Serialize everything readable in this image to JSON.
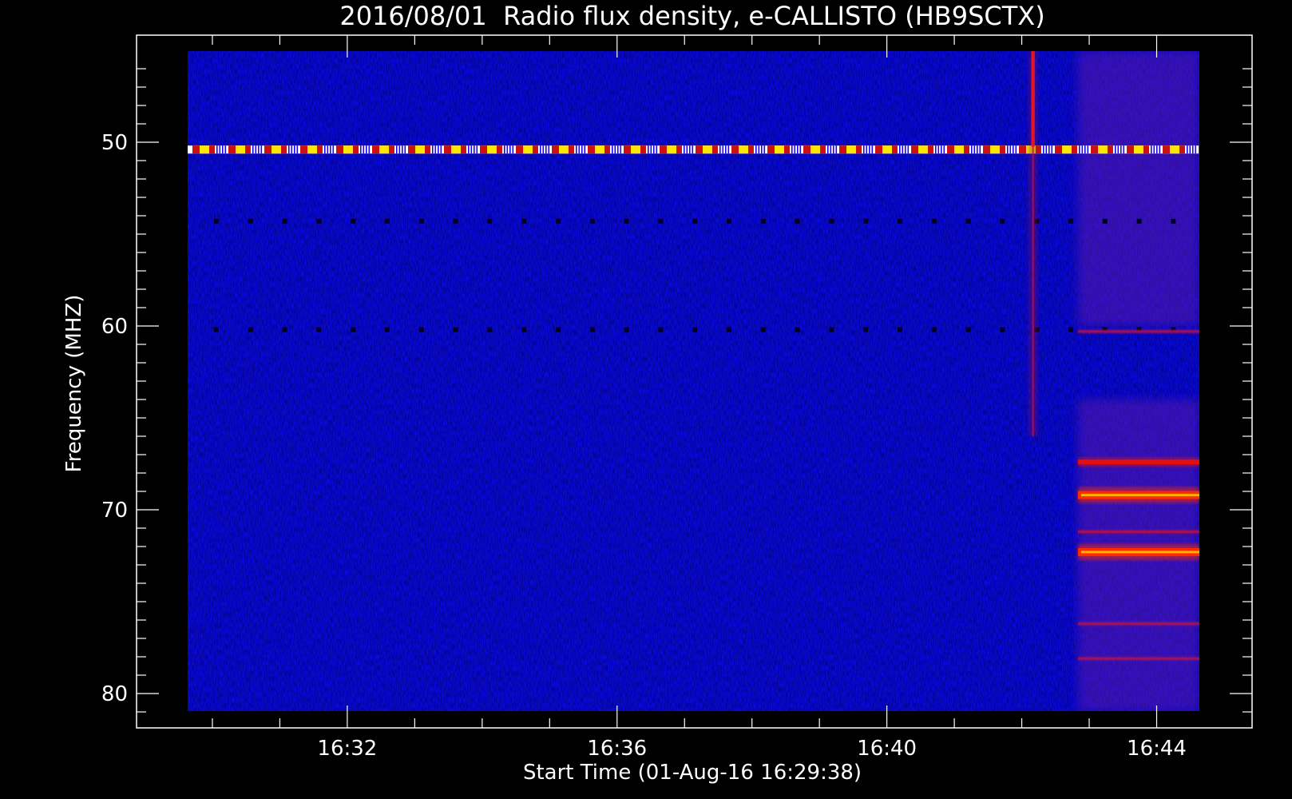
{
  "chart_data": {
    "type": "heatmap",
    "title": "2016/08/01  Radio flux density, e-CALLISTO (HB9SCTX)",
    "xlabel": "Start Time (01-Aug-16 16:29:38)",
    "ylabel": "Frequency (MHZ)",
    "x_range": [
      "16:29:38",
      "16:44:38"
    ],
    "y_range_mhz": [
      45,
      81
    ],
    "y_axis_reversed": true,
    "x_ticks": [
      "16:32",
      "16:36",
      "16:40",
      "16:44"
    ],
    "y_ticks": [
      "50",
      "60",
      "70",
      "80"
    ],
    "colormap": [
      "#000000",
      "#1a00ff",
      "#ff0000",
      "#ffd200",
      "#ffffff"
    ],
    "background_color": "#0a0ae6",
    "features": [
      {
        "kind": "interference-line",
        "freq_mhz": 50.4,
        "from": "16:29:38",
        "to": "16:44:38",
        "intensity": "high",
        "pattern": "dashed"
      },
      {
        "kind": "dropout-line",
        "freq_mhz": 54.3,
        "from": "16:29:38",
        "to": "16:44:38",
        "pattern": "dotted"
      },
      {
        "kind": "dropout-line",
        "freq_mhz": 60.2,
        "from": "16:29:38",
        "to": "16:44:38",
        "pattern": "dotted"
      },
      {
        "kind": "vertical-burst",
        "time": "16:42:10",
        "freq_range_mhz": [
          45,
          66
        ]
      },
      {
        "kind": "emission-band",
        "freq_mhz": 67.4,
        "from": "16:42:50",
        "to": "16:44:38",
        "intensity": "medium"
      },
      {
        "kind": "emission-band",
        "freq_mhz": 69.2,
        "from": "16:42:50",
        "to": "16:44:38",
        "intensity": "high"
      },
      {
        "kind": "emission-band",
        "freq_mhz": 71.2,
        "from": "16:42:50",
        "to": "16:44:38",
        "intensity": "low"
      },
      {
        "kind": "emission-band",
        "freq_mhz": 72.3,
        "from": "16:42:50",
        "to": "16:44:38",
        "intensity": "high"
      },
      {
        "kind": "emission-band",
        "freq_mhz": 76.2,
        "from": "16:42:50",
        "to": "16:44:38",
        "intensity": "low"
      },
      {
        "kind": "emission-band",
        "freq_mhz": 78.1,
        "from": "16:42:50",
        "to": "16:44:38",
        "intensity": "low"
      },
      {
        "kind": "emission-band",
        "freq_mhz": 60.3,
        "from": "16:42:50",
        "to": "16:44:38",
        "intensity": "low"
      },
      {
        "kind": "broadband-haze",
        "freq_range_mhz": [
          64,
          81
        ],
        "from": "16:42:50",
        "to": "16:44:38"
      },
      {
        "kind": "broadband-haze",
        "freq_range_mhz": [
          45,
          60
        ],
        "from": "16:42:50",
        "to": "16:44:38"
      }
    ]
  }
}
